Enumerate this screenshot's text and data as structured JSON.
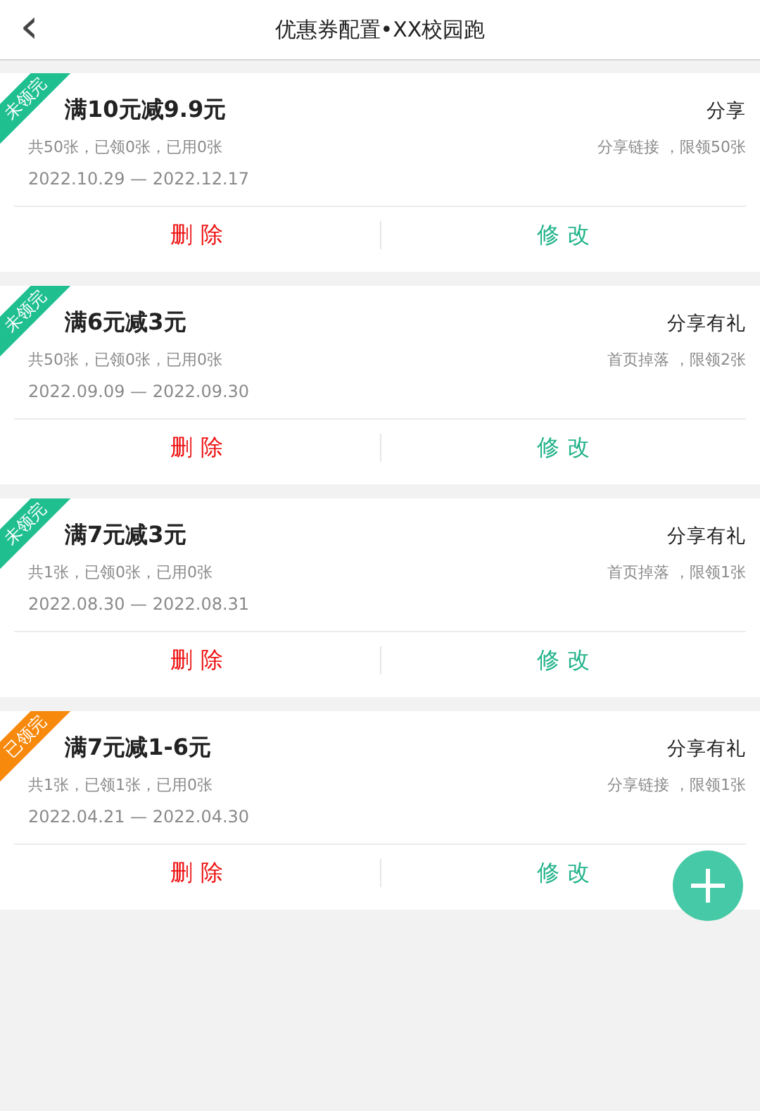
{
  "header": {
    "back": "‹",
    "title": "优惠券配置•XX校园跑"
  },
  "coupons": [
    {
      "ribbon": {
        "label": "未领完",
        "color": "#1fbf8f"
      },
      "title": "满10元减9.9元",
      "type": "分享",
      "stats": "共50张，已领0张，已用0张",
      "rule": "分享链接 ，限领50张",
      "dates": "2022.10.29 — 2022.12.17",
      "delete": "删 除",
      "edit": "修 改"
    },
    {
      "ribbon": {
        "label": "未领完",
        "color": "#1fbf8f"
      },
      "title": "满6元减3元",
      "type": "分享有礼",
      "stats": "共50张，已领0张，已用0张",
      "rule": "首页掉落 ，限领2张",
      "dates": "2022.09.09 — 2022.09.30",
      "delete": "删 除",
      "edit": "修 改"
    },
    {
      "ribbon": {
        "label": "未领完",
        "color": "#1fbf8f"
      },
      "title": "满7元减3元",
      "type": "分享有礼",
      "stats": "共1张，已领0张，已用0张",
      "rule": "首页掉落 ，限领1张",
      "dates": "2022.08.30 — 2022.08.31",
      "delete": "删 除",
      "edit": "修 改"
    },
    {
      "ribbon": {
        "label": "已领完",
        "color": "#f7890c"
      },
      "title": "满7元减1-6元",
      "type": "分享有礼",
      "stats": "共1张，已领1张，已用0张",
      "rule": "分享链接 ，限领1张",
      "dates": "2022.04.21 — 2022.04.30",
      "delete": "删 除",
      "edit": "修 改"
    }
  ]
}
